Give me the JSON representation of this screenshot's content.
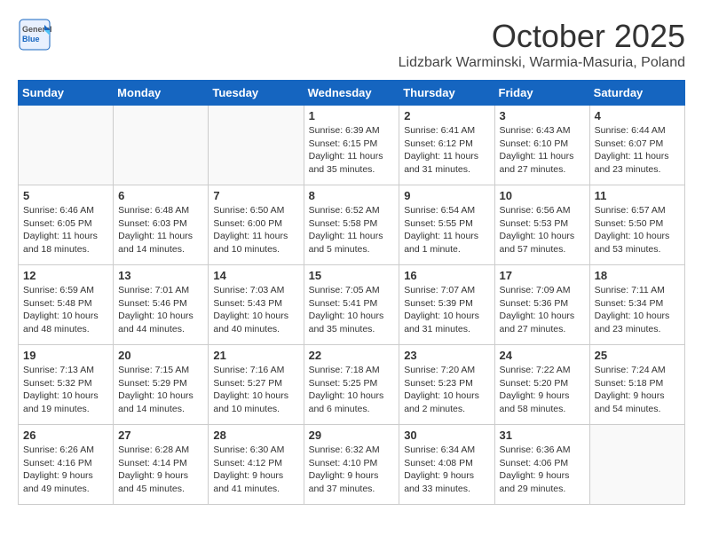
{
  "header": {
    "logo_general": "General",
    "logo_blue": "Blue",
    "month": "October 2025",
    "location": "Lidzbark Warminski, Warmia-Masuria, Poland"
  },
  "days_of_week": [
    "Sunday",
    "Monday",
    "Tuesday",
    "Wednesday",
    "Thursday",
    "Friday",
    "Saturday"
  ],
  "weeks": [
    [
      {
        "day": "",
        "info": ""
      },
      {
        "day": "",
        "info": ""
      },
      {
        "day": "",
        "info": ""
      },
      {
        "day": "1",
        "info": "Sunrise: 6:39 AM\nSunset: 6:15 PM\nDaylight: 11 hours\nand 35 minutes."
      },
      {
        "day": "2",
        "info": "Sunrise: 6:41 AM\nSunset: 6:12 PM\nDaylight: 11 hours\nand 31 minutes."
      },
      {
        "day": "3",
        "info": "Sunrise: 6:43 AM\nSunset: 6:10 PM\nDaylight: 11 hours\nand 27 minutes."
      },
      {
        "day": "4",
        "info": "Sunrise: 6:44 AM\nSunset: 6:07 PM\nDaylight: 11 hours\nand 23 minutes."
      }
    ],
    [
      {
        "day": "5",
        "info": "Sunrise: 6:46 AM\nSunset: 6:05 PM\nDaylight: 11 hours\nand 18 minutes."
      },
      {
        "day": "6",
        "info": "Sunrise: 6:48 AM\nSunset: 6:03 PM\nDaylight: 11 hours\nand 14 minutes."
      },
      {
        "day": "7",
        "info": "Sunrise: 6:50 AM\nSunset: 6:00 PM\nDaylight: 11 hours\nand 10 minutes."
      },
      {
        "day": "8",
        "info": "Sunrise: 6:52 AM\nSunset: 5:58 PM\nDaylight: 11 hours\nand 5 minutes."
      },
      {
        "day": "9",
        "info": "Sunrise: 6:54 AM\nSunset: 5:55 PM\nDaylight: 11 hours\nand 1 minute."
      },
      {
        "day": "10",
        "info": "Sunrise: 6:56 AM\nSunset: 5:53 PM\nDaylight: 10 hours\nand 57 minutes."
      },
      {
        "day": "11",
        "info": "Sunrise: 6:57 AM\nSunset: 5:50 PM\nDaylight: 10 hours\nand 53 minutes."
      }
    ],
    [
      {
        "day": "12",
        "info": "Sunrise: 6:59 AM\nSunset: 5:48 PM\nDaylight: 10 hours\nand 48 minutes."
      },
      {
        "day": "13",
        "info": "Sunrise: 7:01 AM\nSunset: 5:46 PM\nDaylight: 10 hours\nand 44 minutes."
      },
      {
        "day": "14",
        "info": "Sunrise: 7:03 AM\nSunset: 5:43 PM\nDaylight: 10 hours\nand 40 minutes."
      },
      {
        "day": "15",
        "info": "Sunrise: 7:05 AM\nSunset: 5:41 PM\nDaylight: 10 hours\nand 35 minutes."
      },
      {
        "day": "16",
        "info": "Sunrise: 7:07 AM\nSunset: 5:39 PM\nDaylight: 10 hours\nand 31 minutes."
      },
      {
        "day": "17",
        "info": "Sunrise: 7:09 AM\nSunset: 5:36 PM\nDaylight: 10 hours\nand 27 minutes."
      },
      {
        "day": "18",
        "info": "Sunrise: 7:11 AM\nSunset: 5:34 PM\nDaylight: 10 hours\nand 23 minutes."
      }
    ],
    [
      {
        "day": "19",
        "info": "Sunrise: 7:13 AM\nSunset: 5:32 PM\nDaylight: 10 hours\nand 19 minutes."
      },
      {
        "day": "20",
        "info": "Sunrise: 7:15 AM\nSunset: 5:29 PM\nDaylight: 10 hours\nand 14 minutes."
      },
      {
        "day": "21",
        "info": "Sunrise: 7:16 AM\nSunset: 5:27 PM\nDaylight: 10 hours\nand 10 minutes."
      },
      {
        "day": "22",
        "info": "Sunrise: 7:18 AM\nSunset: 5:25 PM\nDaylight: 10 hours\nand 6 minutes."
      },
      {
        "day": "23",
        "info": "Sunrise: 7:20 AM\nSunset: 5:23 PM\nDaylight: 10 hours\nand 2 minutes."
      },
      {
        "day": "24",
        "info": "Sunrise: 7:22 AM\nSunset: 5:20 PM\nDaylight: 9 hours\nand 58 minutes."
      },
      {
        "day": "25",
        "info": "Sunrise: 7:24 AM\nSunset: 5:18 PM\nDaylight: 9 hours\nand 54 minutes."
      }
    ],
    [
      {
        "day": "26",
        "info": "Sunrise: 6:26 AM\nSunset: 4:16 PM\nDaylight: 9 hours\nand 49 minutes."
      },
      {
        "day": "27",
        "info": "Sunrise: 6:28 AM\nSunset: 4:14 PM\nDaylight: 9 hours\nand 45 minutes."
      },
      {
        "day": "28",
        "info": "Sunrise: 6:30 AM\nSunset: 4:12 PM\nDaylight: 9 hours\nand 41 minutes."
      },
      {
        "day": "29",
        "info": "Sunrise: 6:32 AM\nSunset: 4:10 PM\nDaylight: 9 hours\nand 37 minutes."
      },
      {
        "day": "30",
        "info": "Sunrise: 6:34 AM\nSunset: 4:08 PM\nDaylight: 9 hours\nand 33 minutes."
      },
      {
        "day": "31",
        "info": "Sunrise: 6:36 AM\nSunset: 4:06 PM\nDaylight: 9 hours\nand 29 minutes."
      },
      {
        "day": "",
        "info": ""
      }
    ]
  ]
}
